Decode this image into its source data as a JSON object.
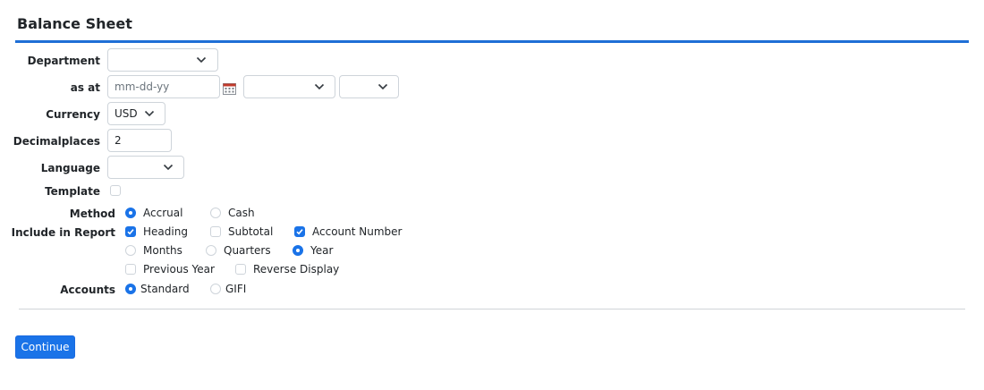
{
  "page": {
    "title": "Balance Sheet"
  },
  "form": {
    "department": {
      "label": "Department",
      "value": ""
    },
    "as_at": {
      "label": "as at",
      "placeholder": "mm-dd-yy",
      "month_value": "",
      "year_value": ""
    },
    "currency": {
      "label": "Currency",
      "value": "USD"
    },
    "decimalplaces": {
      "label": "Decimalplaces",
      "value": "2"
    },
    "language": {
      "label": "Language",
      "value": ""
    },
    "template": {
      "label": "Template",
      "checked": false
    },
    "method": {
      "label": "Method",
      "options": [
        {
          "label": "Accrual",
          "selected": true
        },
        {
          "label": "Cash",
          "selected": false
        }
      ]
    },
    "include": {
      "label": "Include in Report",
      "heading": {
        "label": "Heading",
        "checked": true
      },
      "subtotal": {
        "label": "Subtotal",
        "checked": false
      },
      "account_number": {
        "label": "Account Number",
        "checked": true
      },
      "period": [
        {
          "label": "Months",
          "selected": false
        },
        {
          "label": "Quarters",
          "selected": false
        },
        {
          "label": "Year",
          "selected": true
        }
      ],
      "previous_year": {
        "label": "Previous Year",
        "checked": false
      },
      "reverse_display": {
        "label": "Reverse Display",
        "checked": false
      }
    },
    "accounts": {
      "label": "Accounts",
      "options": [
        {
          "label": "Standard",
          "selected": true
        },
        {
          "label": "GIFI",
          "selected": false
        }
      ]
    }
  },
  "actions": {
    "continue_label": "Continue"
  },
  "colors": {
    "accent": "#1a73e8",
    "rule": "#1f6fd6"
  }
}
